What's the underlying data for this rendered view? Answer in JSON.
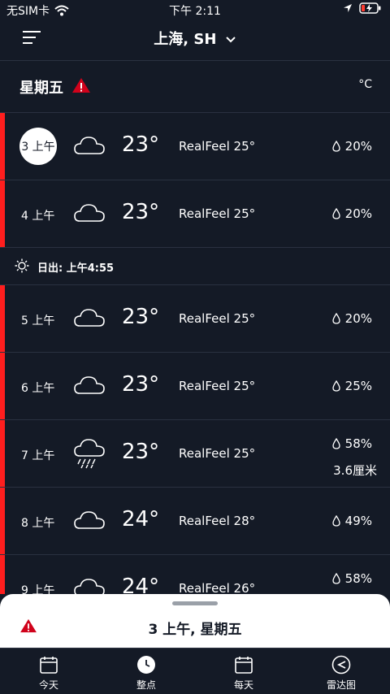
{
  "status": {
    "carrier": "无SIM卡",
    "time": "下午 2:11"
  },
  "header": {
    "location": "上海, SH"
  },
  "day": {
    "title": "星期五",
    "unit": "°C"
  },
  "hours": [
    {
      "time": "3 上午",
      "temp": "23°",
      "realfeel": "RealFeel 25°",
      "precip": "20%",
      "icon": "cloud-icon",
      "selected": true
    },
    {
      "time": "4 上午",
      "temp": "23°",
      "realfeel": "RealFeel 25°",
      "precip": "20%",
      "icon": "cloud-icon"
    },
    {
      "time": "5 上午",
      "temp": "23°",
      "realfeel": "RealFeel 25°",
      "precip": "20%",
      "icon": "cloud-icon"
    },
    {
      "time": "6 上午",
      "temp": "23°",
      "realfeel": "RealFeel 25°",
      "precip": "25%",
      "icon": "cloud-icon"
    },
    {
      "time": "7 上午",
      "temp": "23°",
      "realfeel": "RealFeel 25°",
      "precip": "58%",
      "amount": "3.6厘米",
      "icon": "rain-cloud-icon"
    },
    {
      "time": "8 上午",
      "temp": "24°",
      "realfeel": "RealFeel 28°",
      "precip": "49%",
      "icon": "cloud-icon"
    },
    {
      "time": "9 上午",
      "temp": "24°",
      "realfeel": "RealFeel 26°",
      "precip": "58%",
      "icon": "cloud-icon"
    }
  ],
  "sunrise": {
    "label": "日出: 上午4:55"
  },
  "sheet": {
    "title": "3 上午, 星期五"
  },
  "tabs": [
    {
      "label": "今天",
      "icon": "calendar-icon"
    },
    {
      "label": "整点",
      "icon": "clock-icon"
    },
    {
      "label": "每天",
      "icon": "calendar-icon"
    },
    {
      "label": "雷达图",
      "icon": "radar-icon"
    }
  ],
  "colors": {
    "background": "#141a26",
    "accent": "#ff1e1e",
    "warning": "#d0021b"
  }
}
